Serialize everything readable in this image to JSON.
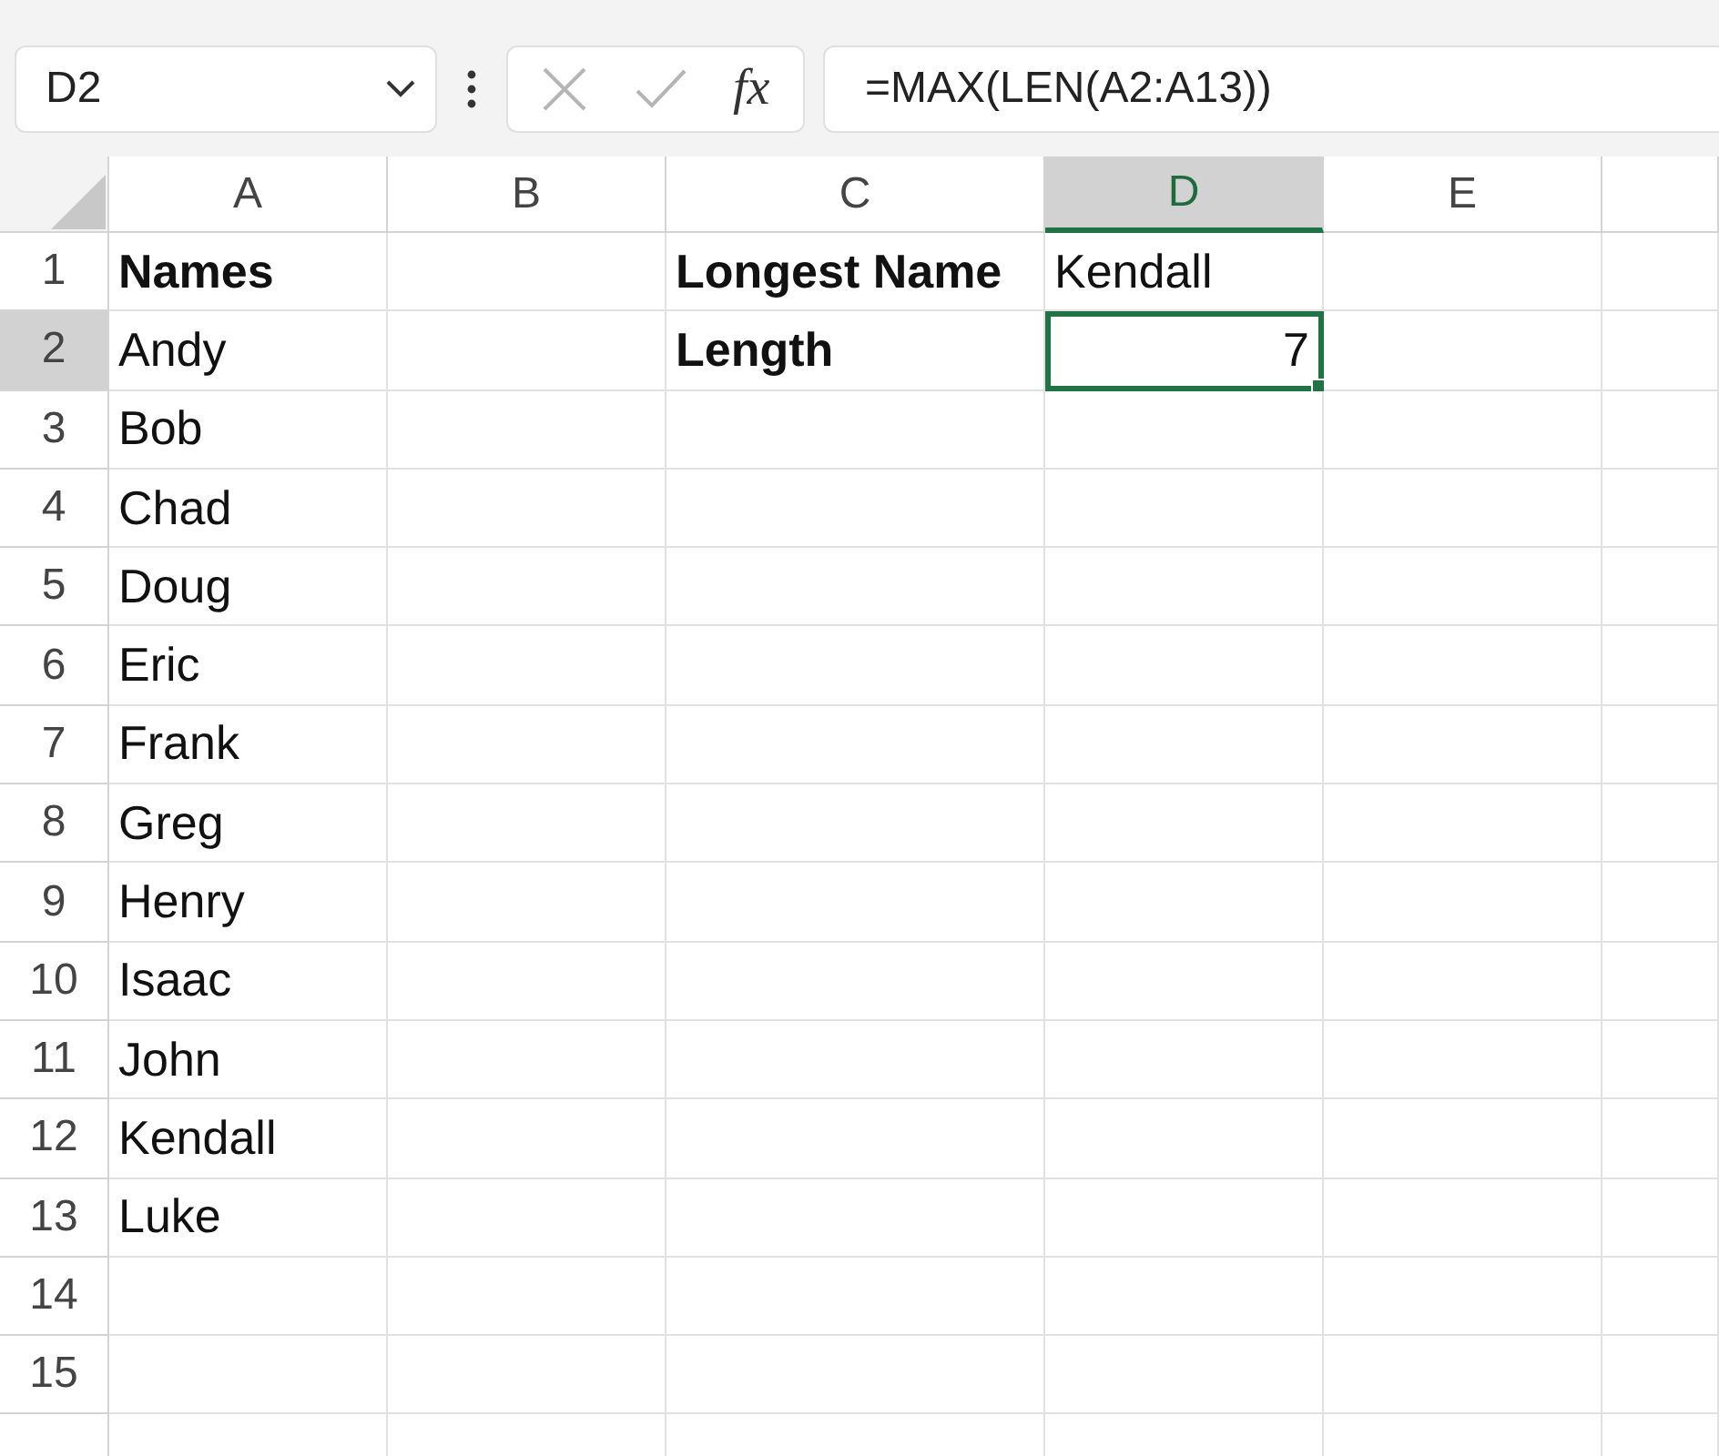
{
  "name_box": {
    "value": "D2"
  },
  "formula_bar": {
    "function_label": "fx",
    "formula": "=MAX(LEN(A2:A13))"
  },
  "columns": [
    {
      "label": "A",
      "selected": false
    },
    {
      "label": "B",
      "selected": false
    },
    {
      "label": "C",
      "selected": false
    },
    {
      "label": "D",
      "selected": true
    },
    {
      "label": "E",
      "selected": false
    }
  ],
  "rows": [
    {
      "label": "1",
      "selected": false,
      "cells": [
        {
          "text": "Names",
          "bold": true,
          "kind": "text",
          "selected": false
        },
        null,
        {
          "text": "Longest Name",
          "bold": true,
          "kind": "text",
          "selected": false
        },
        {
          "text": "Kendall",
          "bold": false,
          "kind": "text",
          "selected": false
        },
        null
      ]
    },
    {
      "label": "2",
      "selected": true,
      "cells": [
        {
          "text": "Andy",
          "bold": false,
          "kind": "text",
          "selected": false
        },
        null,
        {
          "text": "Length",
          "bold": true,
          "kind": "text",
          "selected": false
        },
        {
          "text": "7",
          "bold": false,
          "kind": "number",
          "selected": true
        },
        null
      ]
    },
    {
      "label": "3",
      "selected": false,
      "cells": [
        {
          "text": "Bob",
          "bold": false,
          "kind": "text",
          "selected": false
        }
      ]
    },
    {
      "label": "4",
      "selected": false,
      "cells": [
        {
          "text": "Chad",
          "bold": false,
          "kind": "text",
          "selected": false
        }
      ]
    },
    {
      "label": "5",
      "selected": false,
      "cells": [
        {
          "text": "Doug",
          "bold": false,
          "kind": "text",
          "selected": false
        }
      ]
    },
    {
      "label": "6",
      "selected": false,
      "cells": [
        {
          "text": "Eric",
          "bold": false,
          "kind": "text",
          "selected": false
        }
      ]
    },
    {
      "label": "7",
      "selected": false,
      "cells": [
        {
          "text": "Frank",
          "bold": false,
          "kind": "text",
          "selected": false
        }
      ]
    },
    {
      "label": "8",
      "selected": false,
      "cells": [
        {
          "text": "Greg",
          "bold": false,
          "kind": "text",
          "selected": false
        }
      ]
    },
    {
      "label": "9",
      "selected": false,
      "cells": [
        {
          "text": "Henry",
          "bold": false,
          "kind": "text",
          "selected": false
        }
      ]
    },
    {
      "label": "10",
      "selected": false,
      "cells": [
        {
          "text": "Isaac",
          "bold": false,
          "kind": "text",
          "selected": false
        }
      ]
    },
    {
      "label": "11",
      "selected": false,
      "cells": [
        {
          "text": "John",
          "bold": false,
          "kind": "text",
          "selected": false
        }
      ]
    },
    {
      "label": "12",
      "selected": false,
      "cells": [
        {
          "text": "Kendall",
          "bold": false,
          "kind": "text",
          "selected": false
        }
      ]
    },
    {
      "label": "13",
      "selected": false,
      "cells": [
        {
          "text": "Luke",
          "bold": false,
          "kind": "text",
          "selected": false
        }
      ]
    },
    {
      "label": "14",
      "selected": false
    },
    {
      "label": "15",
      "selected": false
    }
  ]
}
